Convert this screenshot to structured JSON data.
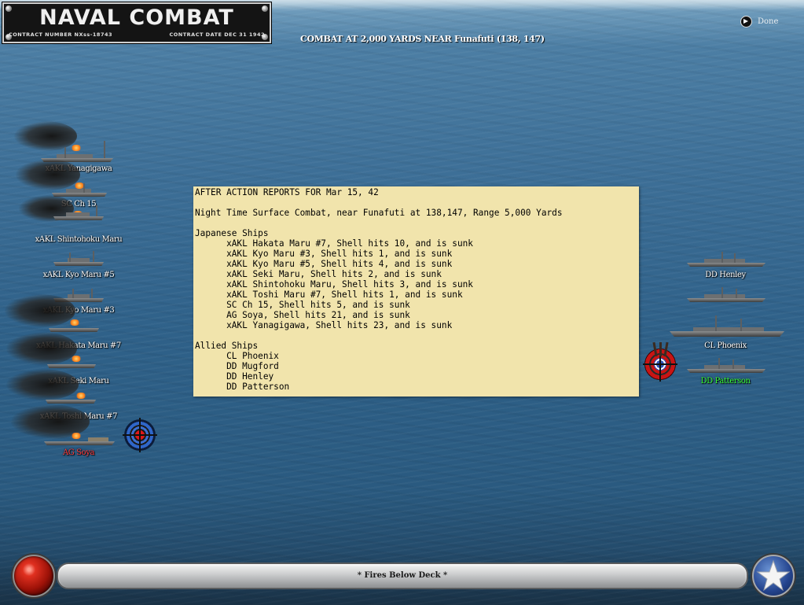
{
  "title_plate": {
    "game_title": "NAVAL COMBAT",
    "contract_number": "CONTRACT NUMBER   NXss-18743",
    "contract_date": "CONTRACT DATE  DEC 31  1942"
  },
  "header": {
    "combat_text": "COMBAT AT 2,000 YARDS NEAR Funafuti (138, 147)",
    "done_label": "Done"
  },
  "japanese_ships": [
    {
      "label": "xAKL Yanagigawa",
      "color": "white",
      "burning": true
    },
    {
      "label": "SC Ch 15",
      "color": "white",
      "burning": true
    },
    {
      "label": "xAKL Shintohoku Maru",
      "color": "white",
      "burning": true
    },
    {
      "label": "xAKL Kyo Maru #5",
      "color": "white",
      "burning": false
    },
    {
      "label": "xAKL Kyo Maru #3",
      "color": "white",
      "burning": true
    },
    {
      "label": "xAKL Hakata Maru #7",
      "color": "white",
      "burning": true
    },
    {
      "label": "xAKL Seki Maru",
      "color": "white",
      "burning": true
    },
    {
      "label": "xAKL Toshi Maru #7",
      "color": "white",
      "burning": true
    },
    {
      "label": "AG Soya",
      "color": "red",
      "burning": true
    }
  ],
  "allied_ships": [
    {
      "label": "DD Henley",
      "color": "white"
    },
    {
      "label": "",
      "color": "white"
    },
    {
      "label": "CL Phoenix",
      "color": "white"
    },
    {
      "label": "DD Patterson",
      "color": "green"
    }
  ],
  "report": {
    "lines": [
      "AFTER ACTION REPORTS FOR Mar 15, 42",
      "",
      "Night Time Surface Combat, near Funafuti at 138,147, Range 5,000 Yards",
      "",
      "Japanese Ships",
      "      xAKL Hakata Maru #7, Shell hits 10, and is sunk",
      "      xAKL Kyo Maru #3, Shell hits 1, and is sunk",
      "      xAKL Kyo Maru #5, Shell hits 4, and is sunk",
      "      xAKL Seki Maru, Shell hits 2, and is sunk",
      "      xAKL Shintohoku Maru, Shell hits 3, and is sunk",
      "      xAKL Toshi Maru #7, Shell hits 1, and is sunk",
      "      SC Ch 15, Shell hits 5, and is sunk",
      "      AG Soya, Shell hits 21, and is sunk",
      "      xAKL Yanagigawa, Shell hits 23, and is sunk",
      "",
      "Allied Ships",
      "      CL Phoenix",
      "      DD Mugford",
      "      DD Henley",
      "      DD Patterson"
    ]
  },
  "status_bar": {
    "message": "* Fires Below Deck *"
  },
  "colors": {
    "report_bg": "#f1e4ac",
    "label_red": "#ff3a3a",
    "label_green": "#39ff39",
    "ocean": "#2f6189"
  }
}
